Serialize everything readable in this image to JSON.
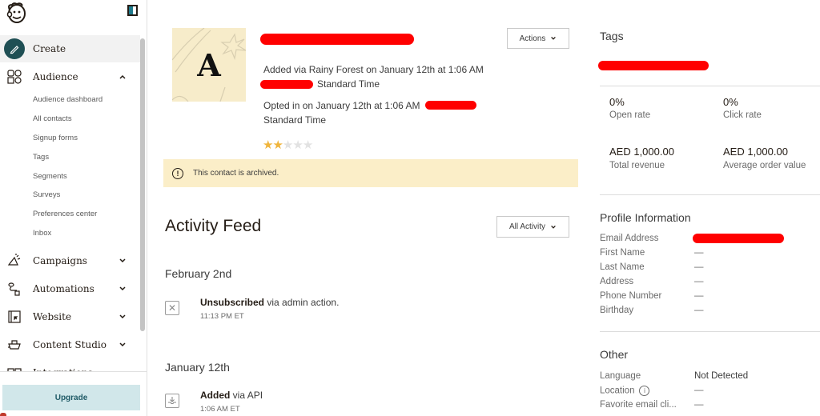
{
  "sidebar": {
    "collapse_icon": "sidebar-toggle-icon",
    "items": [
      {
        "label": "Create",
        "icon": "pencil-icon",
        "active": true
      },
      {
        "label": "Audience",
        "icon": "audience-icon",
        "expanded": true,
        "children": [
          "Audience dashboard",
          "All contacts",
          "Signup forms",
          "Tags",
          "Segments",
          "Surveys",
          "Preferences center",
          "Inbox"
        ]
      },
      {
        "label": "Campaigns",
        "icon": "megaphone-icon"
      },
      {
        "label": "Automations",
        "icon": "automation-icon"
      },
      {
        "label": "Website",
        "icon": "website-icon"
      },
      {
        "label": "Content Studio",
        "icon": "content-studio-icon"
      },
      {
        "label": "Integrations",
        "icon": "integrations-icon"
      }
    ],
    "upgrade_label": "Upgrade"
  },
  "contact": {
    "avatar_letter": "A",
    "added_line1": "Added via Rainy Forest on January 12th at 1:06 AM",
    "added_line2": "Standard Time",
    "opted_line1": "Opted in on January 12th at 1:06 AM",
    "opted_line2": "Standard Time",
    "rating": 2,
    "rating_max": 5,
    "actions_label": "Actions"
  },
  "banner": {
    "text": "This contact is archived.",
    "icon": "alert-circle-icon"
  },
  "feed": {
    "title": "Activity Feed",
    "filter_label": "All Activity",
    "groups": [
      {
        "date": "February 2nd",
        "events": [
          {
            "bold": "Unsubscribed",
            "rest": " via admin action.",
            "time": "11:13 PM ET",
            "icon": "unsubscribe-x-icon"
          }
        ]
      },
      {
        "date": "January 12th",
        "events": [
          {
            "bold": "Added",
            "rest": " via API",
            "time": "1:06 AM ET",
            "icon": "inbox-download-icon"
          }
        ]
      }
    ]
  },
  "right_panel": {
    "tags_title": "Tags",
    "stats": [
      {
        "value": "0%",
        "label": "Open rate"
      },
      {
        "value": "0%",
        "label": "Click rate"
      },
      {
        "value": "AED 1,000.00",
        "label": "Total revenue"
      },
      {
        "value": "AED 1,000.00",
        "label": "Average order value"
      }
    ],
    "profile_title": "Profile Information",
    "profile": [
      {
        "key": "Email Address",
        "value": ""
      },
      {
        "key": "First Name",
        "value": "—"
      },
      {
        "key": "Last Name",
        "value": "—"
      },
      {
        "key": "Address",
        "value": "—"
      },
      {
        "key": "Phone Number",
        "value": "—"
      },
      {
        "key": "Birthday",
        "value": "—"
      }
    ],
    "other_title": "Other",
    "other": [
      {
        "key": "Language",
        "value": "Not Detected"
      },
      {
        "key": "Location",
        "value": "—"
      },
      {
        "key": "Favorite email cli...",
        "value": "—"
      }
    ]
  }
}
